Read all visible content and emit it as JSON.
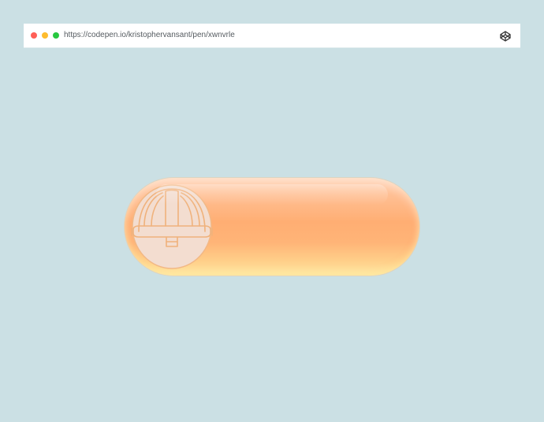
{
  "browser": {
    "url": "https://codepen.io/kristophervansant/pen/xwnvrle",
    "window_controls": [
      "close",
      "minimize",
      "maximize"
    ],
    "brand_icon": "codepen-icon"
  },
  "toggle": {
    "state": "off",
    "knob_icon": "hard-hat-icon"
  },
  "colors": {
    "background": "#cbe0e4",
    "toggle_top": "#ffd3b6",
    "toggle_mid": "#ffae73",
    "toggle_bottom": "#ffeaa7",
    "knob_fill": "#f3ddd0",
    "knob_stroke": "#f3b37f"
  }
}
